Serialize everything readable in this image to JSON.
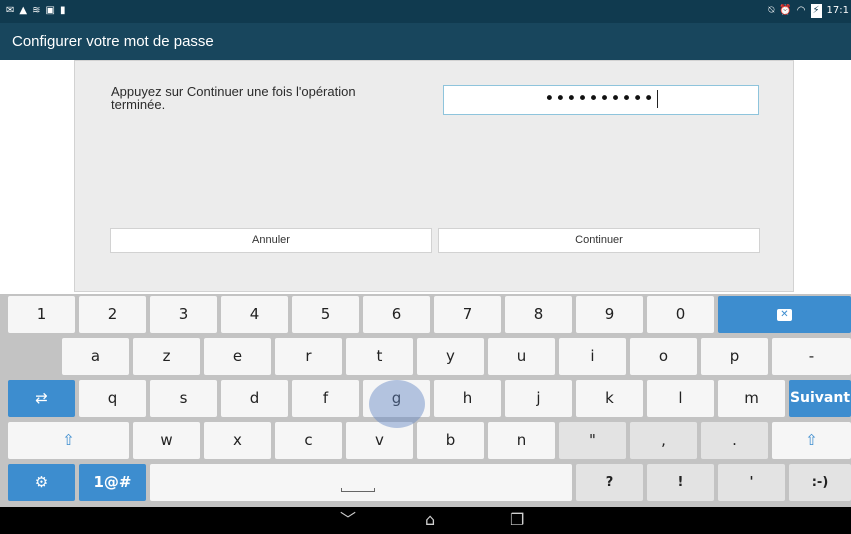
{
  "status_bar": {
    "left_icons": [
      "mail-icon",
      "warning-icon",
      "wifi-signal-icon",
      "image-icon",
      "file-icon"
    ],
    "right_icons": [
      "mute-icon",
      "alarm-icon",
      "wifi-icon",
      "battery-icon"
    ],
    "time": "17:1"
  },
  "action_bar": {
    "title": "Configurer votre mot de passe"
  },
  "dialog": {
    "instruction": "Appuyez sur Continuer une fois l'opération terminée.",
    "password_value": "••••••••••",
    "cancel_label": "Annuler",
    "continue_label": "Continuer"
  },
  "keyboard": {
    "row1": [
      "1",
      "2",
      "3",
      "4",
      "5",
      "6",
      "7",
      "8",
      "9",
      "0"
    ],
    "backspace_icon": "backspace-icon",
    "row2": [
      "a",
      "z",
      "e",
      "r",
      "t",
      "y",
      "u",
      "i",
      "o",
      "p",
      "-"
    ],
    "tab_icon": "tab-icon",
    "row3": [
      "q",
      "s",
      "d",
      "f",
      "g",
      "h",
      "j",
      "k",
      "l",
      "m"
    ],
    "enter_label": "Suivant",
    "shift_icon": "shift-icon",
    "row4": [
      "w",
      "x",
      "c",
      "v",
      "b",
      "n",
      "\"",
      ",",
      "."
    ],
    "settings_icon": "gear-icon",
    "symbols_label": "1@#",
    "space_icon": "space-icon",
    "row5": [
      "?",
      "!",
      "'",
      ":-)"
    ],
    "pressed_key": "g"
  },
  "nav_bar": {
    "icons": [
      "back-icon",
      "home-icon",
      "recent-apps-icon"
    ]
  },
  "colors": {
    "status_bar": "#103a4f",
    "action_bar": "#18465d",
    "accent_blue": "#3d8dcf"
  }
}
